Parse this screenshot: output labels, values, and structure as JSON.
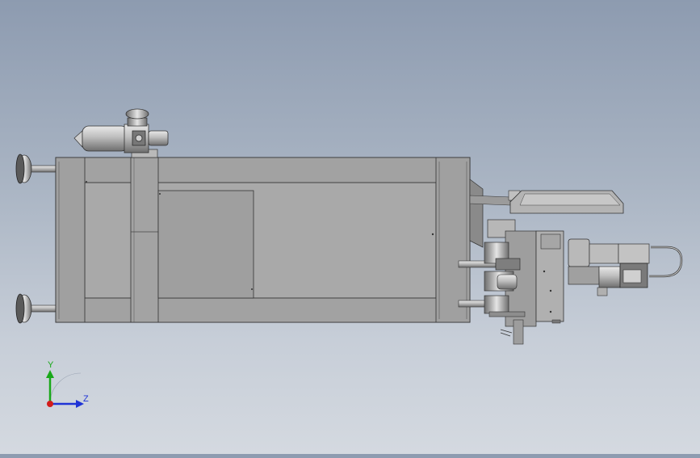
{
  "viewport": {
    "background_top": "#8d9bb0",
    "background_bottom": "#d4d9e0",
    "part_color": "#a7a7a7",
    "part_edge": "#3a3a3a"
  },
  "triad": {
    "y_label": "Y",
    "z_label": "Z",
    "y_color": "#19a819",
    "z_color": "#1f33d6",
    "x_color": "#d21c1c"
  }
}
